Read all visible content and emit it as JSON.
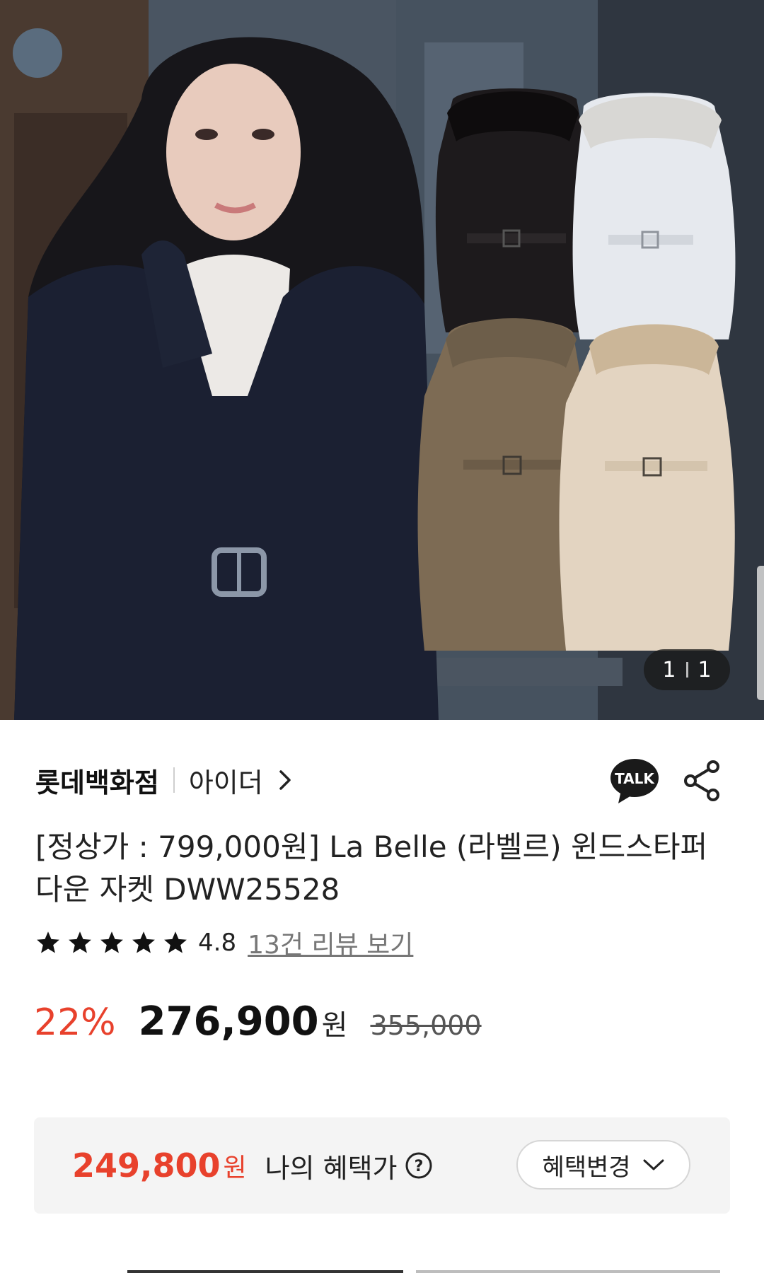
{
  "gallery": {
    "current": "1",
    "total": "1"
  },
  "store": {
    "name": "롯데백화점",
    "brand": "아이더"
  },
  "product": {
    "title": "[정상가 : 799,000원] La Belle (라벨르) 윈드스타퍼 다운 자켓 DWW25528",
    "rating": "4.8",
    "review_link": "13건 리뷰 보기",
    "stars_filled": 5
  },
  "price": {
    "discount": "22%",
    "sale": "276,900",
    "unit": "원",
    "original": "355,000"
  },
  "benefit": {
    "price": "249,800",
    "unit": "원",
    "label": "나의 혜택가",
    "button_label": "혜택변경"
  },
  "colors": {
    "accent_red": "#e8412c"
  },
  "icons": {
    "talk": "talk-icon",
    "share": "share-icon",
    "help": "question-circle-icon",
    "chevron": "chevron-down-icon"
  }
}
